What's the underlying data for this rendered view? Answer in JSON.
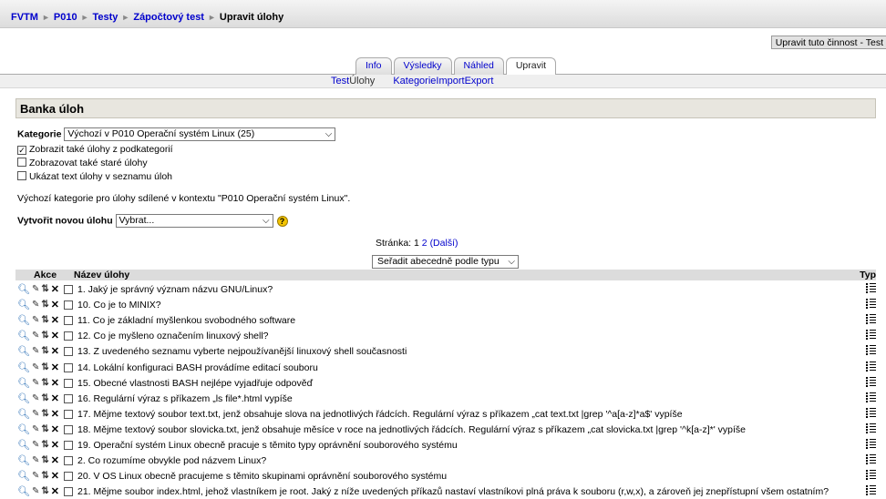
{
  "breadcrumb": {
    "items": [
      "FVTM",
      "P010",
      "Testy",
      "Zápočtový test"
    ],
    "current": "Upravit úlohy",
    "separator": "►"
  },
  "update_button": "Upravit tuto činnost - Test",
  "tabs": [
    "Info",
    "Výsledky",
    "Náhled",
    "Upravit"
  ],
  "active_tab": "Upravit",
  "subtabs": [
    "Test",
    "Úlohy",
    "Kategorie",
    "Import",
    "Export"
  ],
  "active_subtab": "Úlohy",
  "bank": {
    "title": "Banka úloh",
    "category_label": "Kategorie",
    "category_value": "Výchozí v P010 Operační systém Linux (25)",
    "options": [
      {
        "label": "Zobrazit také úlohy z podkategorií",
        "checked": true
      },
      {
        "label": "Zobrazovat také staré úlohy",
        "checked": false
      },
      {
        "label": "Ukázat text úlohy v seznamu úloh",
        "checked": false
      }
    ],
    "info_text": "Výchozí kategorie pro úlohy sdílené v kontextu \"P010 Operační systém Linux\".",
    "create_label": "Vytvořit novou úlohu",
    "create_value": "Vybrat...",
    "help_glyph": "?"
  },
  "pager": {
    "label": "Stránka:",
    "current": "1",
    "next_page": "2",
    "next_label": "(Další)"
  },
  "sort_value": "Seřadit abecedně podle typu",
  "table": {
    "col_actions": "Akce",
    "col_name": "Název úlohy",
    "col_type": "Typ",
    "rows": [
      "1. Jaký je správný význam názvu GNU/Linux?",
      "10. Co je to MINIX?",
      "11. Co je základní myšlenkou svobodného software",
      "12. Co je myšleno označením linuxový shell?",
      "13. Z uvedeného seznamu vyberte nejpoužívanější linuxový shell současnosti",
      "14. Lokální konfiguraci BASH provádíme editací souboru",
      "15. Obecné vlastnosti BASH nejlépe vyjadřuje odpověď",
      "16. Regulární výraz s příkazem „ls file*.html vypíše",
      "17. Mějme textový soubor text.txt, jenž obsahuje slova na jednotlivých řádcích. Regulární výraz s příkazem „cat text.txt |grep '^a[a-z]*a$' vypíše",
      "18. Mějme textový soubor slovicka.txt, jenž obsahuje měsíce v roce na jednotlivých řádcích. Regulární výraz s příkazem „cat slovicka.txt |grep '^k[a-z]*' vypíše",
      "19. Operační systém Linux obecně pracuje s těmito typy oprávnění souborového systému",
      "2. Co rozumíme obvykle pod názvem Linux?",
      "20. V OS Linux obecně pracujeme s těmito skupinami oprávnění souborového systému",
      "21. Mějme soubor index.html, jehož vlastníkem je root. Jaký z níže uvedených příkazů nastaví vlastníkovi plná práva k souboru (r,w,x), a zároveň jej znepřístupní všem ostatním?"
    ]
  },
  "colors": {
    "link": "#0000cc",
    "header_bg": "#e8e6df",
    "table_head_bg": "#dcdcdc",
    "help_icon": "#f3c400"
  },
  "icons": {
    "preview": "preview-icon",
    "edit": "edit-icon",
    "move": "move-icon",
    "delete": "delete-icon",
    "type": "multichoice-type-icon"
  }
}
